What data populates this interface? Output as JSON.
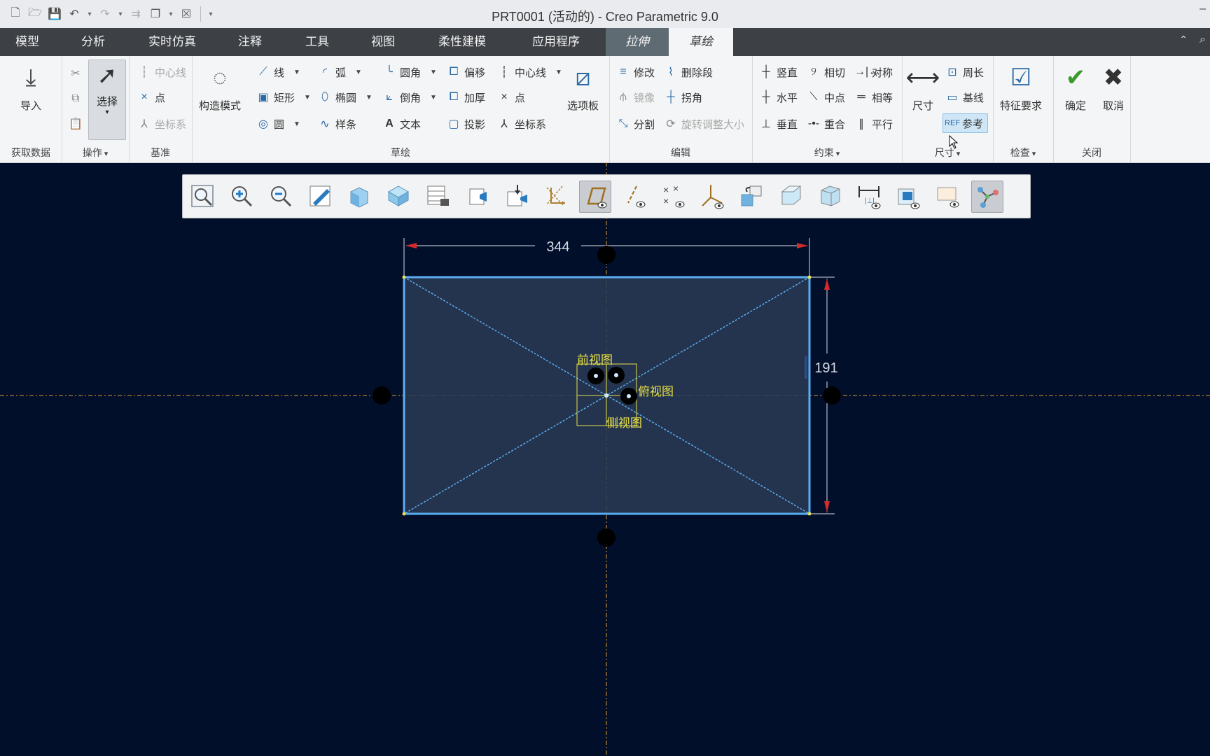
{
  "window": {
    "title": "PRT0001 (活动的) - Creo Parametric 9.0",
    "quick_access": [
      "new-icon",
      "open-icon",
      "save-icon",
      "undo-icon",
      "redo-icon",
      "regenerate-icon",
      "windows-icon",
      "close-window-icon",
      "customize-icon"
    ]
  },
  "tabs": {
    "model": "模型",
    "analysis": "分析",
    "simulation": "实时仿真",
    "annotate": "注释",
    "tools": "工具",
    "view": "视图",
    "flexible": "柔性建模",
    "apps": "应用程序",
    "extrude": "拉伸",
    "sketch": "草绘"
  },
  "ribbon": {
    "get_data": {
      "import": "导入",
      "label": "获取数据"
    },
    "operations": {
      "select": "选择",
      "label": "操作"
    },
    "datum": {
      "centerline": "中心线",
      "point": "点",
      "csys": "坐标系",
      "label": "基准"
    },
    "sketching": {
      "construction": "构造模式",
      "line": "线",
      "rectangle": "矩形",
      "circle": "圆",
      "arc": "弧",
      "ellipse": "椭圆",
      "spline": "样条",
      "fillet": "圆角",
      "chamfer": "倒角",
      "text": "文本",
      "offset": "偏移",
      "thicken": "加厚",
      "project": "投影",
      "centerline": "中心线",
      "point": "点",
      "csys": "坐标系",
      "palette": "选项板",
      "label": "草绘"
    },
    "editing": {
      "modify": "修改",
      "delete_segment": "删除段",
      "mirror": "镜像",
      "corner": "拐角",
      "divide": "分割",
      "rotate_resize": "旋转调整大小",
      "label": "编辑"
    },
    "constrain": {
      "vertical": "竖直",
      "tangent": "相切",
      "symmetric": "对称",
      "horizontal": "水平",
      "midpoint": "中点",
      "equal": "相等",
      "perpendicular": "垂直",
      "coincident": "重合",
      "parallel": "平行",
      "label": "约束"
    },
    "dimension": {
      "dimension": "尺寸",
      "perimeter": "周长",
      "baseline": "基线",
      "reference": "参考",
      "label": "尺寸"
    },
    "inspect": {
      "feature_req": "特征要求",
      "label": "检查"
    },
    "close": {
      "ok": "确定",
      "cancel": "取消",
      "label": "关闭"
    }
  },
  "view_toolbar": [
    "refit-icon",
    "zoom-in-icon",
    "zoom-out-icon",
    "repaint-icon",
    "display-style-icon",
    "saved-orientations-icon",
    "view-manager-icon",
    "perspective-icon",
    "named-view-icon",
    "sketch-view-icon",
    "datum-plane-display-icon",
    "datum-axis-display-icon",
    "point-display-icon",
    "csys-display-icon",
    "spin-center-icon",
    "annotation-display-icon",
    "section-icon",
    "dimension-display-icon",
    "constraint-display-icon",
    "vertex-display-icon",
    "sketcher-display-icon"
  ],
  "sketch": {
    "width_dim": "344",
    "height_dim": "191",
    "front_view": "前视图",
    "top_view": "俯视图",
    "right_view": "侧视图"
  },
  "colors": {
    "canvas": "#010f2b",
    "sketch_line": "#5aaef0",
    "dimension": "#d8dde4",
    "arrow": "#d42a2a",
    "datum": "#d99a30",
    "label": "#e6e048"
  }
}
